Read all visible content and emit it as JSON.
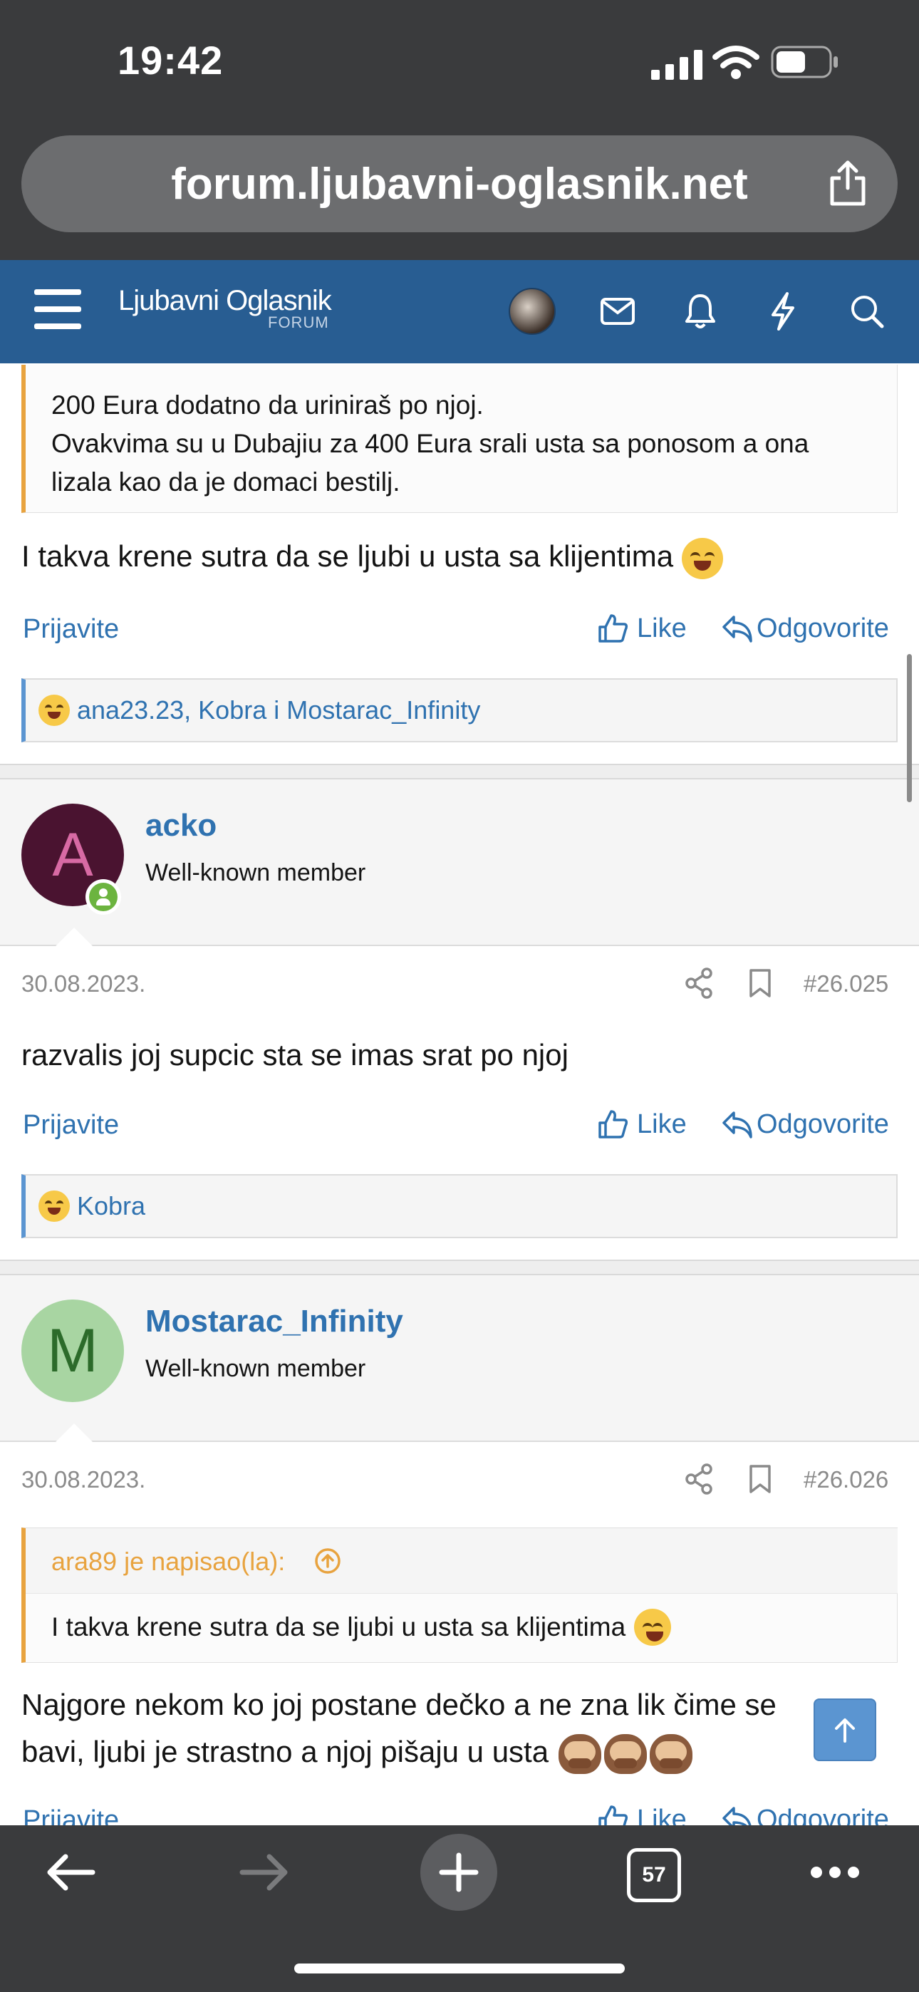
{
  "status_bar": {
    "time": "19:42"
  },
  "browser": {
    "url": "forum.ljubavni-oglasnik.net",
    "tab_count": "57"
  },
  "forum_nav": {
    "logo_text": "Ljubavni Oglasnik",
    "logo_sub": "FORUM"
  },
  "post_top": {
    "quote_lines": [
      "200 Eura dodatno da uriniraš po njoj.",
      "Ovakvima su u Dubajiu za 400 Eura srali usta sa ponosom a ona",
      "lizala kao da je domaci bestilj."
    ],
    "message": "I takva krene sutra da se ljubi u usta sa klijentima",
    "report_label": "Prijavite",
    "like_label": "Like",
    "reply_label": "Odgovorite",
    "reactions": "ana23.23, Kobra i Mostarac_Infinity"
  },
  "post_acko": {
    "avatar_letter": "A",
    "username": "acko",
    "user_title": "Well-known member",
    "date": "30.08.2023.",
    "post_number": "#26.025",
    "message": "razvalis joj supcic sta se imas srat po njoj",
    "report_label": "Prijavite",
    "like_label": "Like",
    "reply_label": "Odgovorite",
    "reactions": "Kobra"
  },
  "post_mostarac": {
    "avatar_letter": "M",
    "username": "Mostarac_Infinity",
    "user_title": "Well-known member",
    "date": "30.08.2023.",
    "post_number": "#26.026",
    "quote_author": "ara89 je napisao(la):",
    "quote_text": "I takva krene sutra da se ljubi u usta sa klijentima",
    "message_line1": "Najgore nekom ko joj postane dečko a ne zna lik čime se",
    "message_line2": "bavi, ljubi je strastno a njoj pišaju u usta",
    "report_label": "Prijavite",
    "like_label": "Like",
    "reply_label": "Odgovorite"
  },
  "colors": {
    "accent": "#2f72b0",
    "nav": "#285d92",
    "quote_bar": "#e8a33f",
    "reaction_bar": "#5b95d1"
  }
}
